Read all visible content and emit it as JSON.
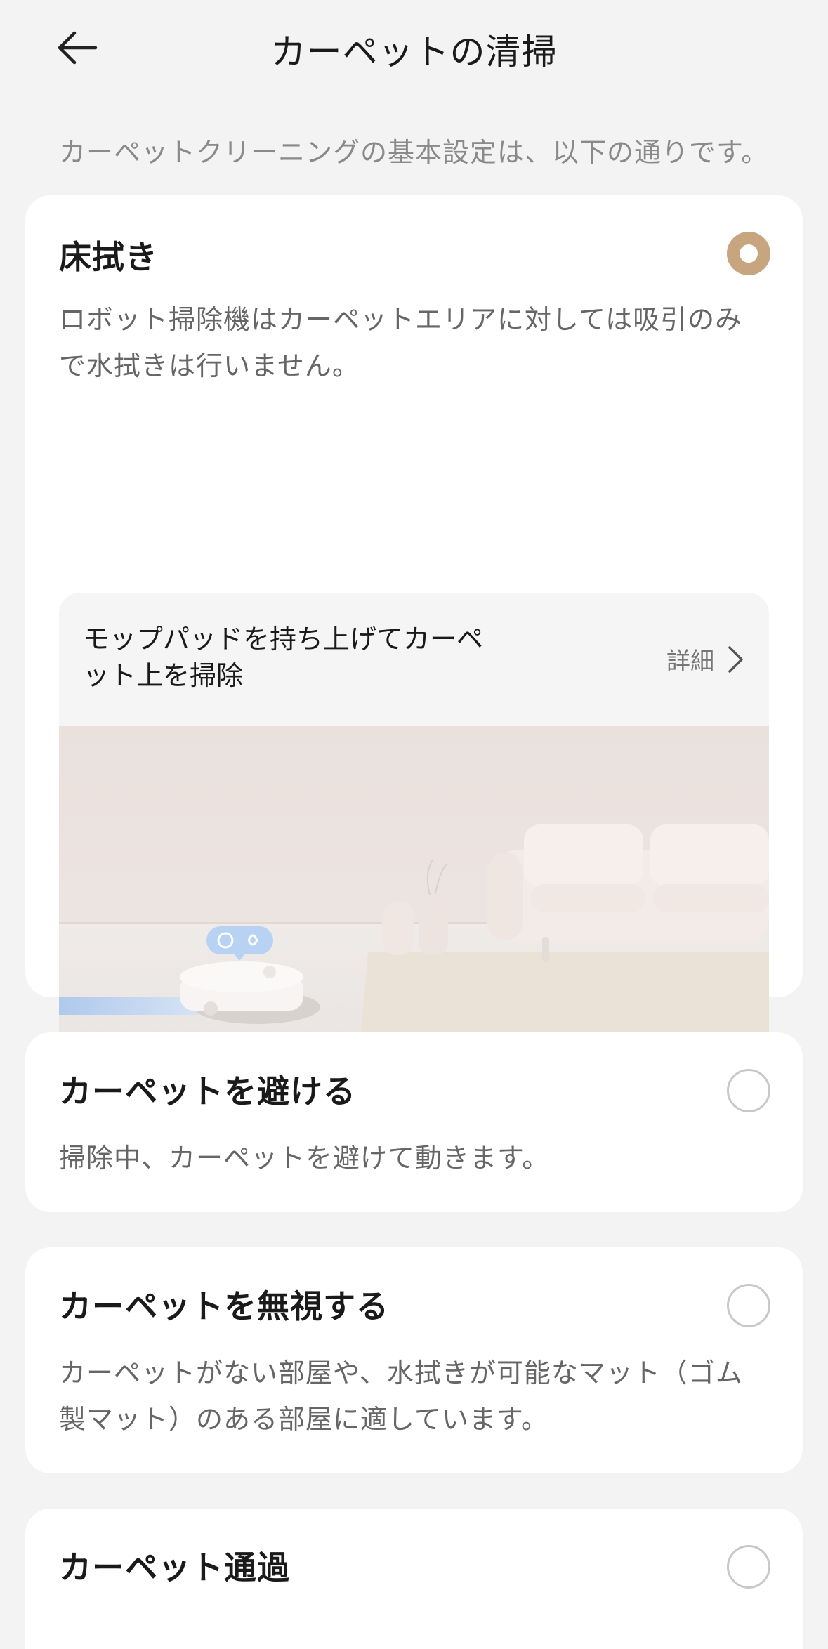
{
  "header": {
    "title": "カーペットの清掃"
  },
  "intro": "カーペットクリーニングの基本設定は、以下の通りです。",
  "options": [
    {
      "title": "床拭き",
      "description": "ロボット掃除機はカーペットエリアに対しては吸引のみで水拭きは行いません。",
      "selected": true,
      "feature": {
        "label": "モップパッドを持ち上げてカーペット上を掃除",
        "detail": "詳細"
      }
    },
    {
      "title": "カーペットを避ける",
      "description": "掃除中、カーペットを避けて動きます。",
      "selected": false
    },
    {
      "title": "カーペットを無視する",
      "description": "カーペットがない部屋や、水拭きが可能なマット（ゴム製マット）のある部屋に適しています。",
      "selected": false
    },
    {
      "title": "カーペット通過",
      "description": "",
      "selected": false
    }
  ],
  "colors": {
    "accent": "#c7a57f",
    "background": "#f3f3f3",
    "card": "#ffffff"
  }
}
